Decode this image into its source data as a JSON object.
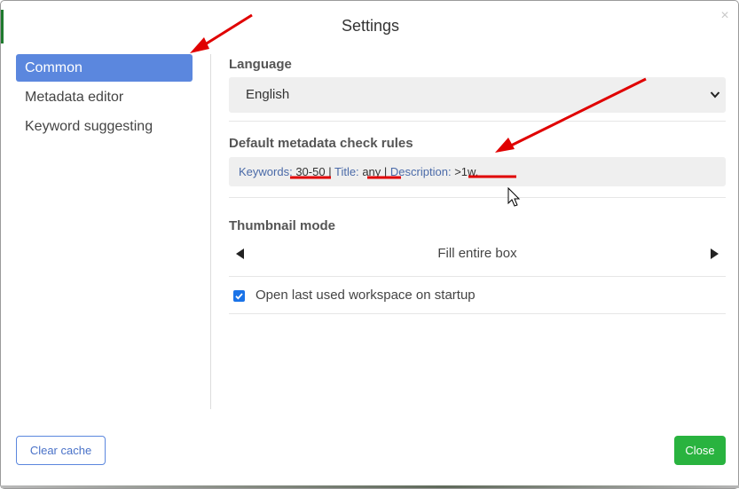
{
  "dialog": {
    "title": "Settings",
    "close_glyph": "×"
  },
  "sidebar": {
    "items": [
      {
        "label": "Common",
        "active": true
      },
      {
        "label": "Metadata editor",
        "active": false
      },
      {
        "label": "Keyword suggesting",
        "active": false
      }
    ]
  },
  "language": {
    "label": "Language",
    "value": "English"
  },
  "metadata_rules": {
    "label": "Default metadata check rules",
    "keywords_label": "Keywords:",
    "keywords_value": "30-50",
    "title_label": "Title:",
    "title_value": "any",
    "description_label": "Description:",
    "description_value": ">1w.",
    "separator": "|"
  },
  "thumbnail": {
    "label": "Thumbnail mode",
    "value": "Fill entire box"
  },
  "startup": {
    "label": "Open last used workspace on startup",
    "checked": true
  },
  "buttons": {
    "clear_cache": "Clear cache",
    "close": "Close"
  },
  "colors": {
    "accent": "#5b87de",
    "close_button": "#29b33f",
    "annotation": "#e00000"
  },
  "icons": [
    "close-icon",
    "chevron-down-icon",
    "arrow-left-icon",
    "arrow-right-icon",
    "checkmark-icon",
    "mouse-cursor-icon"
  ]
}
